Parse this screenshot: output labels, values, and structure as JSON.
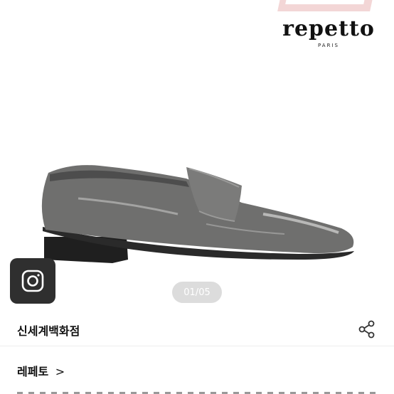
{
  "product_image": {
    "brand_logo_text": "repetto",
    "brand_logo_sub": "PARIS",
    "subject": "grey patent loafer",
    "colors": {
      "shoe": "#6f6f6e",
      "sole": "#1f1f1f",
      "ribbon": "#f3d6d6"
    }
  },
  "gallery": {
    "counter": "01/05"
  },
  "social": {
    "icon": "instagram-icon"
  },
  "store": {
    "name": "신세계백화점",
    "share_icon": "share-icon"
  },
  "brand_link": {
    "label": "레페토",
    "chevron": ">"
  }
}
